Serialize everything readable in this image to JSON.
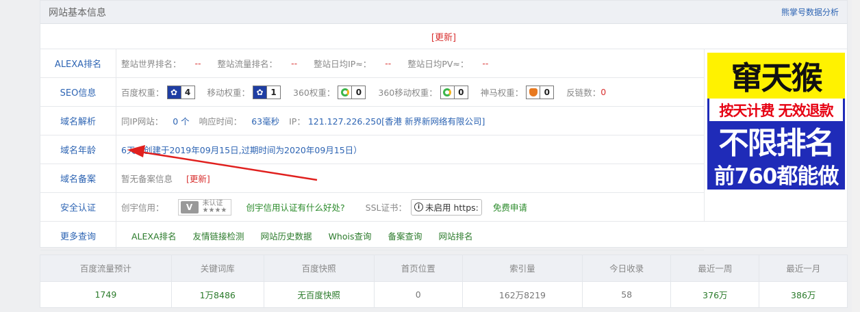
{
  "header": {
    "title": "网站基本信息",
    "link": "熊掌号数据分析"
  },
  "update_label": "[更新]",
  "alexa": {
    "label": "ALEXA排名",
    "items": [
      {
        "label": "整站世界排名：",
        "value": "--"
      },
      {
        "label": "整站流量排名：",
        "value": "--"
      },
      {
        "label": "整站日均IP≈：",
        "value": "--"
      },
      {
        "label": "整站日均PV≈：",
        "value": "--"
      }
    ]
  },
  "seo": {
    "label": "SEO信息",
    "baidu_label": "百度权重：",
    "baidu_value": "4",
    "mobile_label": "移动权重：",
    "mobile_value": "1",
    "s360_label": "360权重：",
    "s360_value": "0",
    "s360m_label": "360移动权重：",
    "s360m_value": "0",
    "shenma_label": "神马权重：",
    "shenma_value": "0",
    "backlink_label": "反链数：",
    "backlink_value": "0"
  },
  "dns": {
    "label": "域名解析",
    "sameip_label": "同IP网站：",
    "sameip_value": "0 个",
    "resp_label": "响应时间：",
    "resp_value": "63毫秒",
    "ip_label": "IP：",
    "ip_value": "121.127.226.250[香港 新界新网络有限公司]"
  },
  "age": {
    "label": "域名年龄",
    "value": "6天（创建于2019年09月15日,过期时间为2020年09月15日）"
  },
  "beian": {
    "label": "域名备案",
    "value": "暂无备案信息",
    "update": "[更新]"
  },
  "security": {
    "label": "安全认证",
    "chuangyu_label": "创宇信用：",
    "cert_mark": "V",
    "cert_text": "未认证",
    "cert_stars": "★★★★",
    "chuangyu_link": "创宇信用认证有什么好处?",
    "ssl_label": "SSL证书：",
    "info_glyph": "i",
    "https_text": "未启用 https:",
    "apply_link": "免费申请"
  },
  "more": {
    "label": "更多查询",
    "links": [
      "ALEXA排名",
      "友情链接检测",
      "网站历史数据",
      "Whois查询",
      "备案查询",
      "网站排名"
    ]
  },
  "ad": {
    "line1": "窜天猴",
    "line2": "按天计费 无效退款",
    "line3": "不限排名",
    "line4": "前760都能做"
  },
  "stats": {
    "headers": [
      "百度流量预计",
      "关键词库",
      "百度快照",
      "首页位置",
      "索引量",
      "今日收录",
      "最近一周",
      "最近一月"
    ],
    "values": [
      "1749",
      "1万8486",
      "无百度快照",
      "0",
      "162万8219",
      "58",
      "376万",
      "386万"
    ]
  },
  "colors": {
    "accent_red": "#d8302f",
    "link_blue": "#2d64b3",
    "link_green": "#2a7a2a",
    "annotation_arrow": "#e0201e"
  }
}
